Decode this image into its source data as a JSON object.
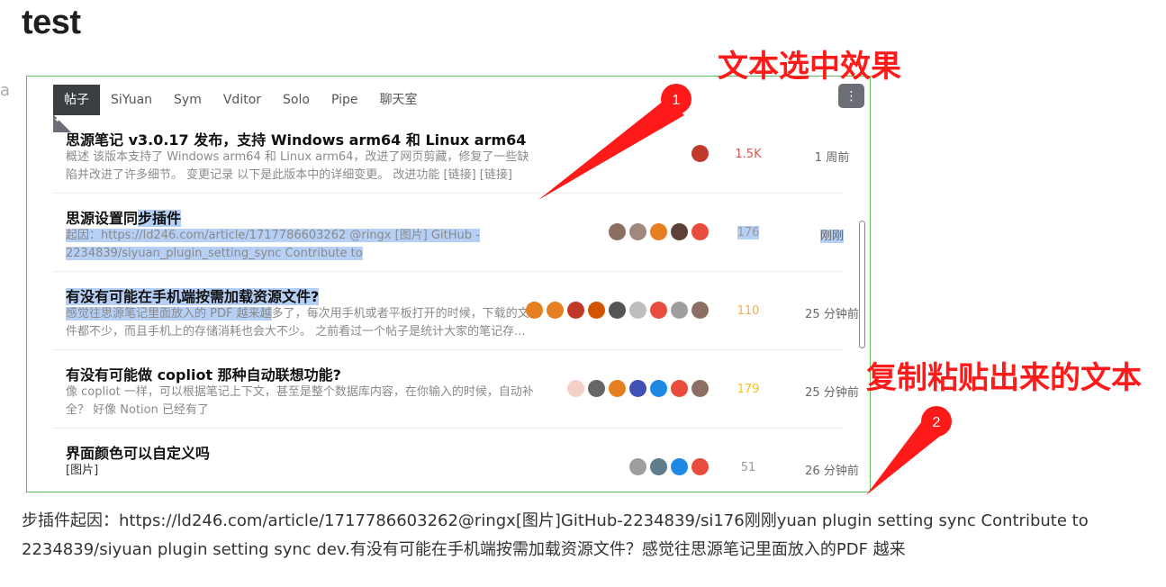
{
  "page": {
    "title": "test",
    "side_glyph": "a"
  },
  "tabs": [
    {
      "label": "帖子",
      "active": true
    },
    {
      "label": "SiYuan",
      "active": false
    },
    {
      "label": "Sym",
      "active": false
    },
    {
      "label": "Vditor",
      "active": false
    },
    {
      "label": "Solo",
      "active": false
    },
    {
      "label": "Pipe",
      "active": false
    },
    {
      "label": "聊天室",
      "active": false
    }
  ],
  "menu_icon": "⋮",
  "rows": [
    {
      "title": "思源笔记 v3.0.17 发布，支持 Windows arm64 和 Linux arm64",
      "excerpt": "概述 该版本支持了 Windows arm64 和 Linux arm64，改进了网页剪藏，修复了一些缺陷并改进了许多细节。 变更记录 以下是此版本中的详细变更。 改进功能 [链接] [链接] [链...",
      "count": "1.5K",
      "count_color": "#d9534f",
      "time": "1 周前",
      "avatar_colors": [
        "#c0392b"
      ]
    },
    {
      "title_pre": "思源设置同",
      "title_sel": "步插件",
      "excerpt": "起因：https://ld246.com/article/1717786603262 @ringx [图片] GitHub - 2234839/siyuan_plugin_setting_sync Contribute to 2234839/siyuan_plugin_setting_sync dev...",
      "count": "176",
      "count_color": "#999999",
      "time": "刚刚",
      "avatar_colors": [
        "#8d6e63",
        "#a1887f",
        "#e67e22",
        "#5d4037",
        "#e74c3c"
      ]
    },
    {
      "title": "有没有可能在手机端按需加载资源文件?",
      "excerpt_sel": "感觉往思源笔记里面放入的 PDF 越来越",
      "excerpt_rest": "多了，每次用手机或者平板打开的时候，下载的文件都不少，而且手机上的存储消耗也会大不少。 之前看过一个帖子是统计大家的笔记存...",
      "count": "110",
      "count_color": "#f0ad4e",
      "time": "25 分钟前",
      "avatar_colors": [
        "#e67e22",
        "#e67e22",
        "#c0392b",
        "#d35400",
        "#555555",
        "#bdbdbd",
        "#e74c3c",
        "#9e9e9e",
        "#8d6e63"
      ]
    },
    {
      "title": "有没有可能做 copliot 那种自动联想功能?",
      "excerpt": "像 copliot 一样，可以根据笔记上下文，甚至是整个数据库内容，在你输入的时候，自动补全？ 好像 Notion 已经有了",
      "count": "179",
      "count_color": "#f0c419",
      "time": "25 分钟前",
      "avatar_colors": [
        "#f5d0c5",
        "#666666",
        "#e67e22",
        "#3f51b5",
        "#1e88e5",
        "#e74c3c",
        "#8d6e63"
      ]
    },
    {
      "title": "界面颜色可以自定义吗",
      "excerpt": "[图片]",
      "count": "51",
      "count_color": "#999999",
      "time": "26 分钟前",
      "avatar_colors": [
        "#9e9e9e",
        "#607d8b",
        "#1e88e5",
        "#e74c3c"
      ]
    }
  ],
  "annotations": {
    "label1": "文本选中效果",
    "marker1": "1",
    "label2": "复制粘贴出来的文本",
    "marker2": "2"
  },
  "pasted_text": "步插件起因：https://ld246.com/article/1717786603262@ringx[图片]GitHub-2234839/si176刚刚yuan plugin setting sync Contribute to 2234839/siyuan plugin setting sync dev.有没有可能在手机端按需加载资源文件？感觉往思源笔记里面放入的PDF 越来"
}
